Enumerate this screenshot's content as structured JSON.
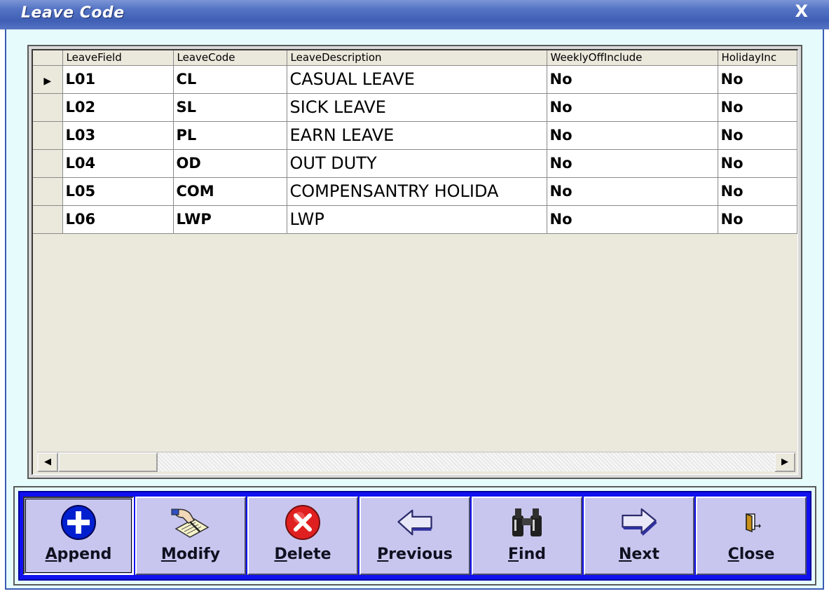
{
  "window": {
    "title": "Leave Code",
    "close_label": "X"
  },
  "grid": {
    "columns": [
      "LeaveField",
      "LeaveCode",
      "LeaveDescription",
      "WeeklyOffInclude",
      "HolidayInc"
    ],
    "rows": [
      {
        "field": "L01",
        "code": "CL",
        "description": "CASUAL LEAVE",
        "weekly_off": "No",
        "holiday": "No",
        "current": true
      },
      {
        "field": "L02",
        "code": "SL",
        "description": "SICK LEAVE",
        "weekly_off": "No",
        "holiday": "No"
      },
      {
        "field": "L03",
        "code": "PL",
        "description": "EARN LEAVE",
        "weekly_off": "No",
        "holiday": "No"
      },
      {
        "field": "L04",
        "code": "OD",
        "description": "OUT DUTY",
        "weekly_off": "No",
        "holiday": "No"
      },
      {
        "field": "L05",
        "code": "COM",
        "description": "COMPENSANTRY HOLIDA",
        "weekly_off": "No",
        "holiday": "No"
      },
      {
        "field": "L06",
        "code": "LWP",
        "description": "LWP",
        "weekly_off": "No",
        "holiday": "No"
      }
    ]
  },
  "toolbar": {
    "append": {
      "label_hot": "A",
      "label_rest": "ppend",
      "icon": "plus-circle-icon"
    },
    "modify": {
      "label_hot": "M",
      "label_rest": "odify",
      "icon": "hand-writing-icon"
    },
    "delete": {
      "label_hot": "D",
      "label_rest": "elete",
      "icon": "red-x-circle-icon"
    },
    "previous": {
      "label_hot": "P",
      "label_rest": "revious",
      "icon": "arrow-left-icon"
    },
    "find": {
      "label_hot": "F",
      "label_rest": "ind",
      "icon": "binoculars-icon"
    },
    "next": {
      "label_hot": "N",
      "label_rest": "ext",
      "icon": "arrow-right-icon"
    },
    "close": {
      "label_hot": "C",
      "label_rest": "lose",
      "icon": "exit-door-icon"
    }
  },
  "colors": {
    "title_bar": "#3f5fb5",
    "form_background": "#e6fcfc",
    "toolbar_background": "#1010f0",
    "button_face": "#c8c6ee",
    "delete_red": "#e02020",
    "append_blue": "#0020d0"
  }
}
